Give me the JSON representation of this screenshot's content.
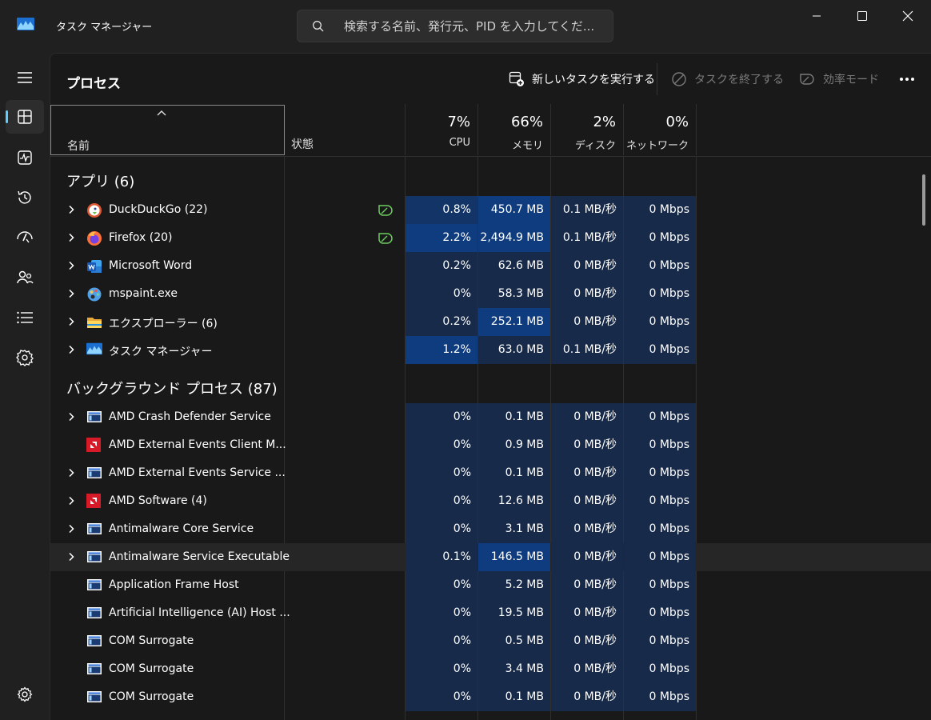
{
  "window": {
    "title": "タスク マネージャー",
    "search_placeholder": "検索する名前、発行元、PID を入力してくだ...",
    "controls": [
      "minimize",
      "maximize",
      "close"
    ]
  },
  "sidebar": {
    "items": [
      {
        "name": "menu",
        "icon": "hamburger-icon"
      },
      {
        "name": "processes",
        "icon": "processes-icon",
        "active": true
      },
      {
        "name": "performance",
        "icon": "performance-icon"
      },
      {
        "name": "app-history",
        "icon": "history-icon"
      },
      {
        "name": "startup-apps",
        "icon": "startup-icon"
      },
      {
        "name": "users",
        "icon": "users-icon"
      },
      {
        "name": "details",
        "icon": "details-icon"
      },
      {
        "name": "services",
        "icon": "services-icon"
      },
      {
        "name": "settings",
        "icon": "gear-icon"
      }
    ]
  },
  "toolbar": {
    "page_title": "プロセス",
    "run_new_task": "新しいタスクを実行する",
    "end_task": "タスクを終了する",
    "efficiency_mode": "効率モード"
  },
  "table": {
    "columns": {
      "name": "名前",
      "status": "状態",
      "cpu": {
        "pct": "7%",
        "label": "CPU"
      },
      "memory": {
        "pct": "66%",
        "label": "メモリ"
      },
      "disk": {
        "pct": "2%",
        "label": "ディスク"
      },
      "network": {
        "pct": "0%",
        "label": "ネットワーク"
      }
    },
    "sections": {
      "apps": "アプリ (6)",
      "background": "バックグラウンド プロセス (87)"
    },
    "apps": [
      {
        "name": "DuckDuckGo (22)",
        "icon": "duckduckgo-icon",
        "expand": true,
        "efficiency": true,
        "cpu": "0.8%",
        "mem": "450.7 MB",
        "disk": "0.1 MB/秒",
        "net": "0 Mbps"
      },
      {
        "name": "Firefox (20)",
        "icon": "firefox-icon",
        "expand": true,
        "efficiency": true,
        "cpu": "2.2%",
        "mem": "2,494.9 MB",
        "disk": "0.1 MB/秒",
        "net": "0 Mbps"
      },
      {
        "name": "Microsoft Word",
        "icon": "word-icon",
        "expand": true,
        "efficiency": false,
        "cpu": "0.2%",
        "mem": "62.6 MB",
        "disk": "0 MB/秒",
        "net": "0 Mbps"
      },
      {
        "name": "mspaint.exe",
        "icon": "paint-icon",
        "expand": true,
        "efficiency": false,
        "cpu": "0%",
        "mem": "58.3 MB",
        "disk": "0 MB/秒",
        "net": "0 Mbps"
      },
      {
        "name": "エクスプローラー (6)",
        "icon": "folder-icon",
        "expand": true,
        "efficiency": false,
        "cpu": "0.2%",
        "mem": "252.1 MB",
        "disk": "0 MB/秒",
        "net": "0 Mbps"
      },
      {
        "name": "タスク マネージャー",
        "icon": "taskmanager-icon",
        "expand": true,
        "efficiency": false,
        "cpu": "1.2%",
        "mem": "63.0 MB",
        "disk": "0.1 MB/秒",
        "net": "0 Mbps"
      }
    ],
    "background": [
      {
        "name": "AMD Crash Defender Service",
        "icon": "service-icon",
        "expand": true,
        "cpu": "0%",
        "mem": "0.1 MB",
        "disk": "0 MB/秒",
        "net": "0 Mbps"
      },
      {
        "name": "AMD External Events Client M...",
        "icon": "amd-icon",
        "expand": false,
        "cpu": "0%",
        "mem": "0.9 MB",
        "disk": "0 MB/秒",
        "net": "0 Mbps"
      },
      {
        "name": "AMD External Events Service ...",
        "icon": "service-icon",
        "expand": true,
        "cpu": "0%",
        "mem": "0.1 MB",
        "disk": "0 MB/秒",
        "net": "0 Mbps"
      },
      {
        "name": "AMD Software (4)",
        "icon": "amd-icon",
        "expand": true,
        "cpu": "0%",
        "mem": "12.6 MB",
        "disk": "0 MB/秒",
        "net": "0 Mbps"
      },
      {
        "name": "Antimalware Core Service",
        "icon": "service-icon",
        "expand": true,
        "cpu": "0%",
        "mem": "3.1 MB",
        "disk": "0 MB/秒",
        "net": "0 Mbps"
      },
      {
        "name": "Antimalware Service Executable",
        "icon": "service-icon",
        "expand": true,
        "hover": true,
        "cpu": "0.1%",
        "mem": "146.5 MB",
        "disk": "0 MB/秒",
        "net": "0 Mbps"
      },
      {
        "name": "Application Frame Host",
        "icon": "service-icon",
        "expand": false,
        "cpu": "0%",
        "mem": "5.2 MB",
        "disk": "0 MB/秒",
        "net": "0 Mbps"
      },
      {
        "name": "Artificial Intelligence (AI) Host ...",
        "icon": "service-icon",
        "expand": false,
        "cpu": "0%",
        "mem": "19.5 MB",
        "disk": "0 MB/秒",
        "net": "0 Mbps"
      },
      {
        "name": "COM Surrogate",
        "icon": "service-icon",
        "expand": false,
        "cpu": "0%",
        "mem": "0.5 MB",
        "disk": "0 MB/秒",
        "net": "0 Mbps"
      },
      {
        "name": "COM Surrogate",
        "icon": "service-icon",
        "expand": false,
        "cpu": "0%",
        "mem": "3.4 MB",
        "disk": "0 MB/秒",
        "net": "0 Mbps"
      },
      {
        "name": "COM Surrogate",
        "icon": "service-icon",
        "expand": false,
        "cpu": "0%",
        "mem": "0.1 MB",
        "disk": "0 MB/秒",
        "net": "0 Mbps"
      }
    ]
  },
  "colors": {
    "accent": "#60cdff",
    "heat_low": "#172a4a",
    "heat_mid": "#123466",
    "heat_high": "#0e3c7e",
    "efficiency_leaf": "#6ccb5f"
  }
}
